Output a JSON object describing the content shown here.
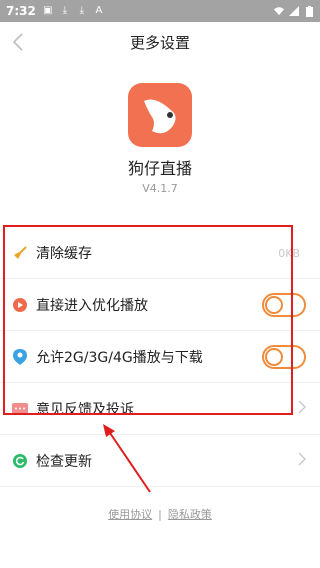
{
  "status_bar": {
    "time": "7:32"
  },
  "nav": {
    "title": "更多设置"
  },
  "app": {
    "name": "狗仔直播",
    "version": "V4.1.7"
  },
  "settings": [
    {
      "label": "清除缓存",
      "value": "0KB",
      "type": "value",
      "icon": "broom-icon",
      "icon_color": "#e8a72a"
    },
    {
      "label": "直接进入优化播放",
      "type": "toggle",
      "icon": "play-circle-icon",
      "icon_color": "#ef6a4a",
      "on": false
    },
    {
      "label": "允许2G/3G/4G播放与下载",
      "type": "toggle",
      "icon": "location-pin-icon",
      "icon_color": "#3aa3e3",
      "on": false
    },
    {
      "label": "意见反馈及投诉",
      "type": "chevron",
      "icon": "chat-bubble-icon",
      "icon_color": "#f08d8d"
    },
    {
      "label": "检查更新",
      "type": "chevron",
      "icon": "refresh-icon",
      "icon_color": "#2bbb6a"
    }
  ],
  "footer": {
    "terms": "使用协议",
    "separator": "|",
    "privacy": "隐私政策"
  },
  "colors": {
    "accent": "#ef8b3b",
    "annotation": "#e01e1e",
    "logo_bg": "#f27150"
  }
}
